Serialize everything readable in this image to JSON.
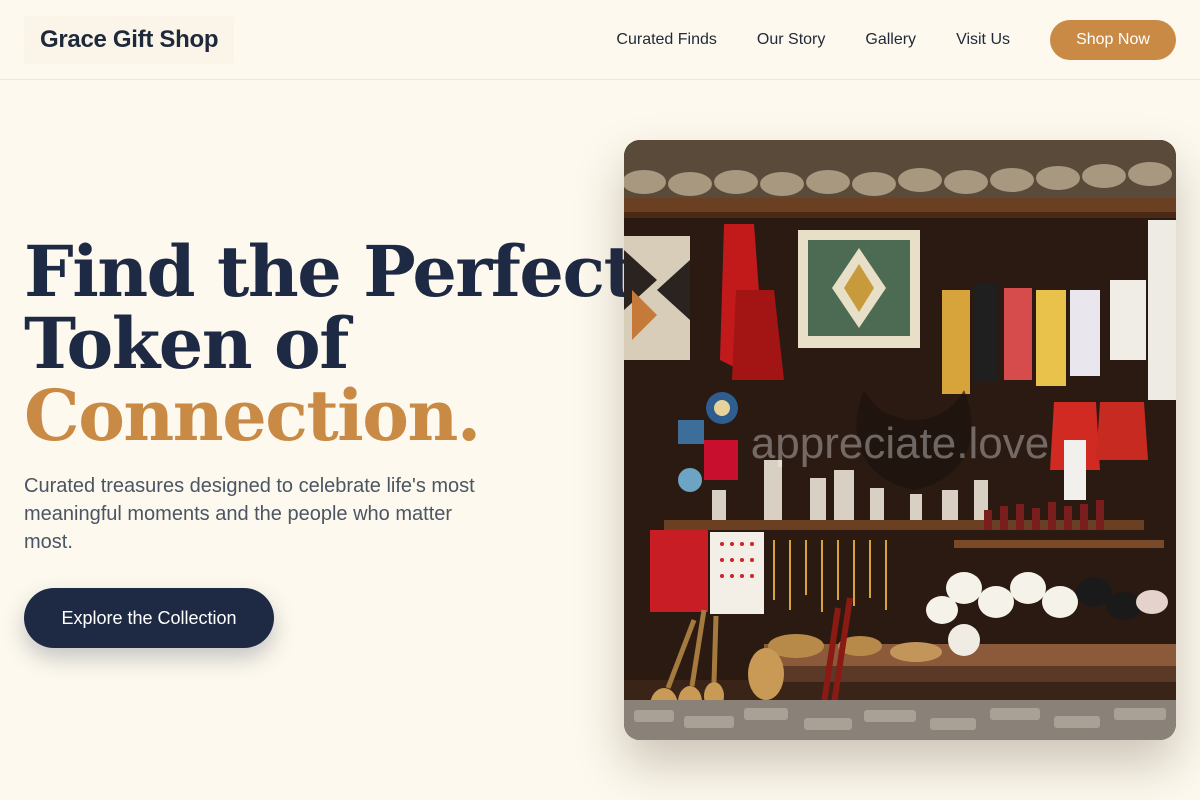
{
  "brand": {
    "name": "Grace Gift Shop"
  },
  "nav": {
    "items": [
      "Curated Finds",
      "Our Story",
      "Gallery",
      "Visit Us"
    ],
    "cta": "Shop Now"
  },
  "hero": {
    "headline_line1": "Find the Perfect",
    "headline_line2": "Token of",
    "headline_accent": "Connection.",
    "subtitle": "Curated treasures designed to celebrate life's most meaningful moments and the people who matter most.",
    "cta": "Explore the Collection",
    "image_watermark": "appreciate.love"
  },
  "colors": {
    "background": "#fdf9ee",
    "navy": "#1e2a44",
    "accent": "#c98a45"
  }
}
